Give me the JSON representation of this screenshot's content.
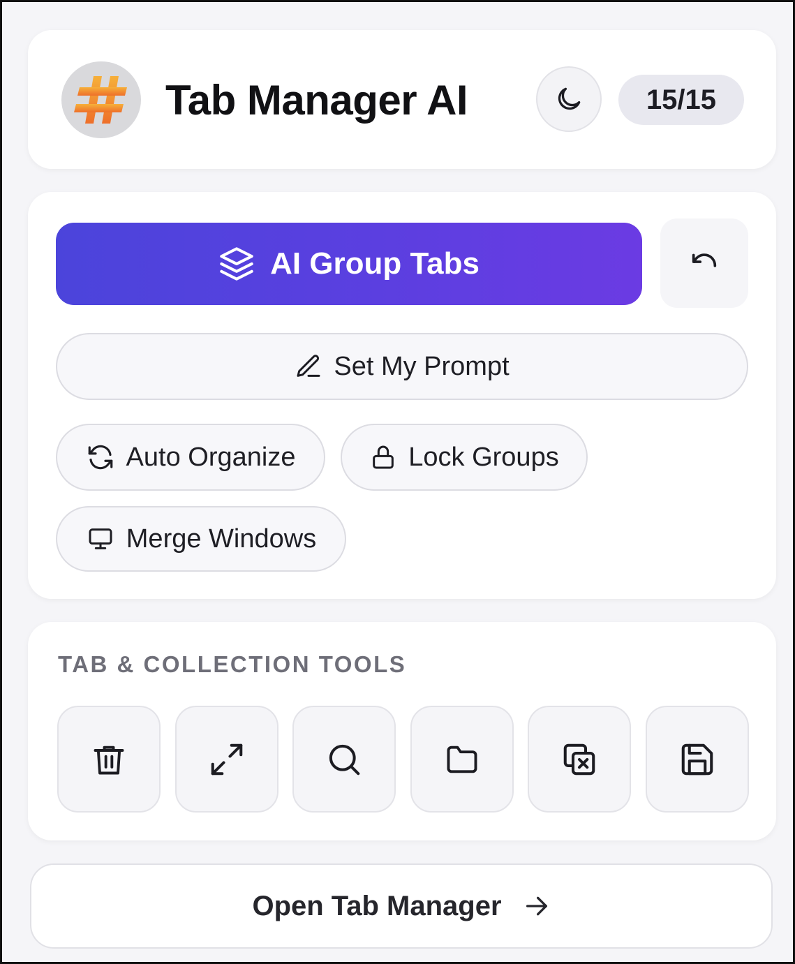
{
  "header": {
    "logo_icon": "hash-logo-icon",
    "title": "Tab Manager AI",
    "theme_icon": "moon-icon",
    "tab_count": "15/15"
  },
  "actions": {
    "ai_group": {
      "icon": "layers-icon",
      "label": "AI Group Tabs"
    },
    "undo": {
      "icon": "undo-icon"
    },
    "set_prompt": {
      "icon": "pencil-icon",
      "label": "Set My Prompt"
    },
    "auto_organize": {
      "icon": "refresh-icon",
      "label": "Auto Organize"
    },
    "lock_groups": {
      "icon": "lock-icon",
      "label": "Lock Groups"
    },
    "merge_windows": {
      "icon": "monitor-icon",
      "label": "Merge Windows"
    }
  },
  "tools": {
    "heading": "TAB & COLLECTION TOOLS",
    "items": [
      {
        "icon": "trash-icon"
      },
      {
        "icon": "expand-icon"
      },
      {
        "icon": "search-icon"
      },
      {
        "icon": "folder-icon"
      },
      {
        "icon": "close-duplicates-icon"
      },
      {
        "icon": "save-icon"
      }
    ]
  },
  "footer": {
    "open_label": "Open Tab Manager",
    "open_icon": "arrow-right-icon"
  },
  "colors": {
    "accent_start": "#4b44db",
    "accent_end": "#6b3be3",
    "logo_orange": "#f0962f"
  }
}
